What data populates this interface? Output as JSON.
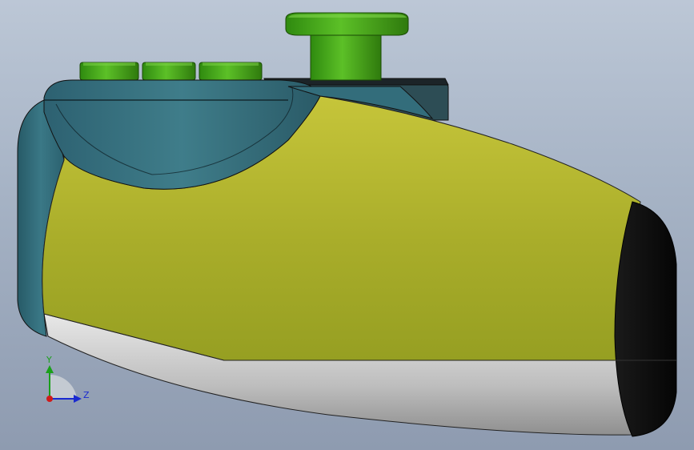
{
  "viewport": {
    "background_top": "#bcc7d6",
    "background_bottom": "#8e9bb0"
  },
  "model": {
    "colors": {
      "teal": "#2f6775",
      "teal_light": "#3f8090",
      "yellow": "#b8b930",
      "yellow_dark": "#8f9a23",
      "grey": "#c9c9c9",
      "black": "#101010",
      "green": "#4aa81a",
      "green_dark": "#2f7a0d",
      "dark_block": "#2d3940"
    },
    "parts": [
      "body-shell",
      "side-panel",
      "top-cap",
      "end-cap",
      "joystick-knob",
      "buttons"
    ]
  },
  "triad": {
    "y_label": "Y",
    "z_label": "Z"
  }
}
